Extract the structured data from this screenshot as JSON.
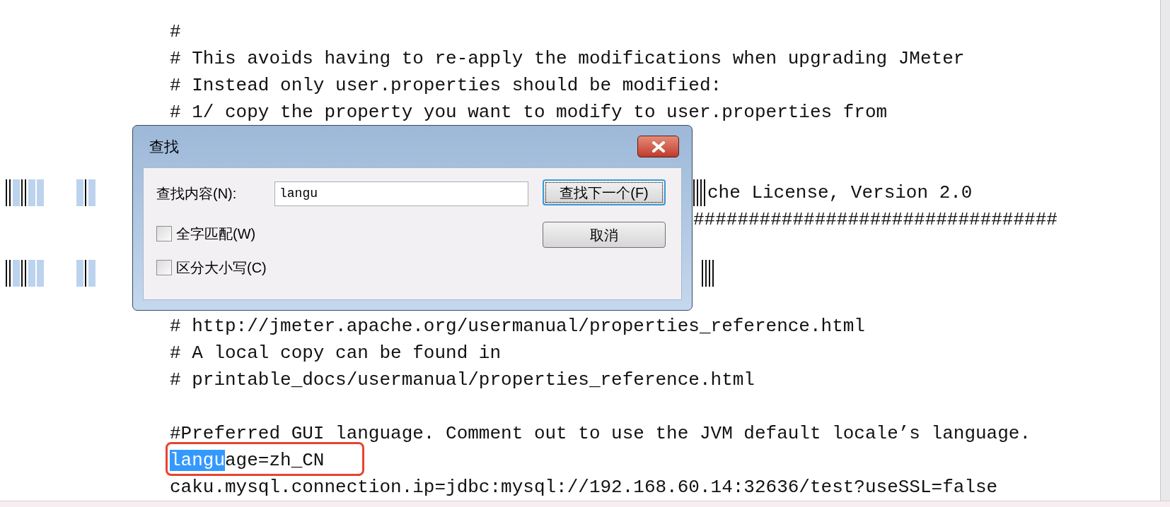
{
  "editor": {
    "lines": [
      {
        "kind": "text",
        "text": "#"
      },
      {
        "kind": "text",
        "text": "# This avoids having to re-apply the modifications when upgrading JMeter"
      },
      {
        "kind": "text",
        "text": "# Instead only user.properties should be modified:"
      },
      {
        "kind": "text",
        "text": "# 1/ copy the property you want to modify to user.properties from"
      },
      {
        "kind": "blank"
      },
      {
        "kind": "blank"
      },
      {
        "kind": "covered",
        "glitch": true,
        "text": "che License, Version 2.0"
      },
      {
        "kind": "covered",
        "glitch": false,
        "text": "#################################"
      },
      {
        "kind": "blank"
      },
      {
        "kind": "glitch"
      },
      {
        "kind": "blank"
      },
      {
        "kind": "text",
        "text": "# http://jmeter.apache.org/usermanual/properties_reference.html"
      },
      {
        "kind": "text",
        "text": "# A local copy can be found in"
      },
      {
        "kind": "text",
        "text": "# printable_docs/usermanual/properties_reference.html"
      },
      {
        "kind": "blank"
      },
      {
        "kind": "text",
        "text": "#Preferred GUI language. Comment out to use the JVM default locale’s language."
      },
      {
        "kind": "match",
        "match": "langu",
        "rest": "age=zh_CN",
        "annotated": true
      },
      {
        "kind": "text",
        "text": "caku.mysql.connection.ip=jdbc:mysql://192.168.60.14:32636/test?useSSL=false"
      }
    ]
  },
  "find_dialog": {
    "title": "查找",
    "find_label": "查找内容(N):",
    "find_value": "langu",
    "find_next_button": "查找下一个(F)",
    "cancel_button": "取消",
    "options": [
      {
        "label": "全字匹配(W)",
        "checked": false
      },
      {
        "label": "区分大小写(C)",
        "checked": false
      }
    ]
  }
}
